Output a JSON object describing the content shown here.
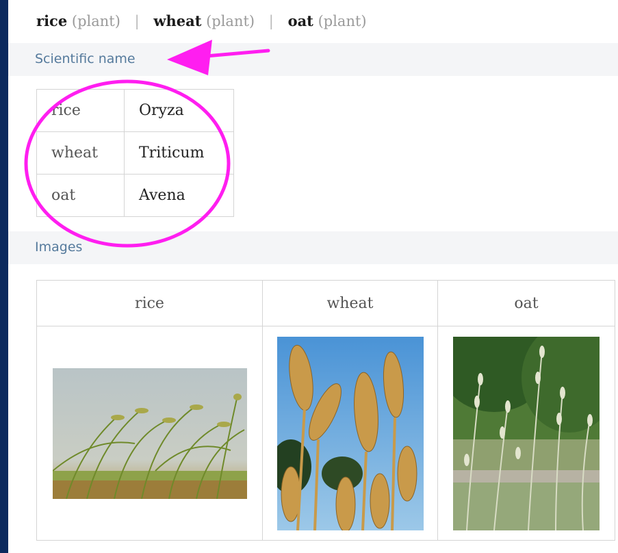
{
  "input_line": {
    "items": [
      {
        "word": "rice",
        "type": "(plant)"
      },
      {
        "word": "wheat",
        "type": "(plant)"
      },
      {
        "word": "oat",
        "type": "(plant)"
      }
    ],
    "separator": "|"
  },
  "pods": {
    "scientific_name": {
      "title": "Scientific name",
      "rows": [
        {
          "plant": "rice",
          "name": "Oryza"
        },
        {
          "plant": "wheat",
          "name": "Triticum"
        },
        {
          "plant": "oat",
          "name": "Avena"
        }
      ]
    },
    "images": {
      "title": "Images",
      "columns": [
        "rice",
        "wheat",
        "oat"
      ]
    }
  },
  "colors": {
    "background": "#0c2a5e",
    "pod_title": "#557a9c",
    "annotation": "#ff1ef0"
  }
}
